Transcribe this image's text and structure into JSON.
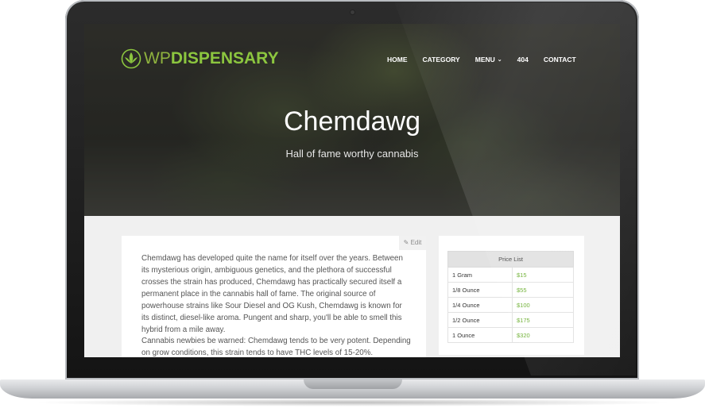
{
  "site": {
    "logo_wp": "WP",
    "logo_dispensary": "DISPENSARY",
    "brand_color": "#8cc63f"
  },
  "nav": [
    {
      "label": "HOME"
    },
    {
      "label": "CATEGORY"
    },
    {
      "label": "MENU",
      "has_dropdown": true
    },
    {
      "label": "404"
    },
    {
      "label": "CONTACT"
    }
  ],
  "hero": {
    "title": "Chemdawg",
    "subtitle": "Hall of fame worthy cannabis"
  },
  "article": {
    "edit_label": "Edit",
    "paragraph1": "Chemdawg has developed quite the name for itself over the years. Between its mysterious origin, ambiguous genetics, and the plethora of successful crosses the strain has produced, Chemdawg has practically secured itself a permanent place in the cannabis hall of fame. The original source of powerhouse strains like Sour Diesel and OG Kush, Chemdawg is known for its distinct, diesel-like aroma. Pungent and sharp, you'll be able to smell this hybrid from a mile away.",
    "paragraph2": "Cannabis newbies be warned: Chemdawg tends to be very potent. Depending on grow conditions, this strain tends to have THC levels of 15-20%."
  },
  "price_list": {
    "heading": "Price List",
    "rows": [
      {
        "label": "1 Gram",
        "price": "$15"
      },
      {
        "label": "1/8 Ounce",
        "price": "$55"
      },
      {
        "label": "1/4 Ounce",
        "price": "$100"
      },
      {
        "label": "1/2 Ounce",
        "price": "$175"
      },
      {
        "label": "1 Ounce",
        "price": "$320"
      }
    ]
  }
}
